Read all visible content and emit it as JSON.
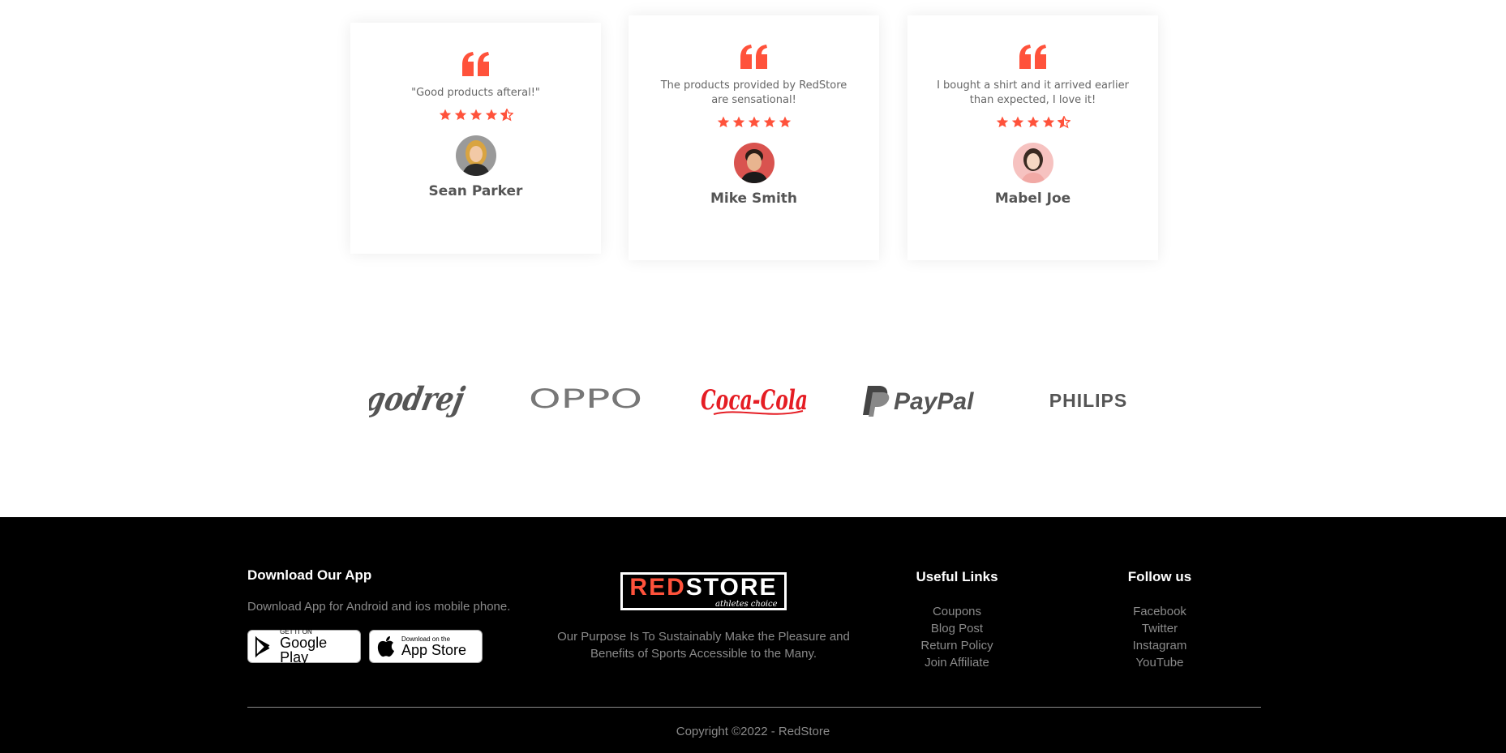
{
  "testimonials": [
    {
      "comment": "\"Good products afteral!\"",
      "rating": 4.5,
      "name": "Sean Parker"
    },
    {
      "comment": "The products provided by RedStore are sensational!",
      "rating": 5,
      "name": "Mike Smith"
    },
    {
      "comment": "I bought a shirt and it arrived earlier than expected, I love it!",
      "rating": 4.5,
      "name": "Mabel Joe"
    }
  ],
  "brands": [
    "godrej",
    "OPPO",
    "Coca-Cola",
    "PayPal",
    "PHILIPS"
  ],
  "footer": {
    "app": {
      "heading": "Download Our App",
      "text": "Download App for Android and ios mobile phone.",
      "google_small": "GET IT ON",
      "google_big": "Google Play",
      "apple_small": "Download on the",
      "apple_big": "App Store"
    },
    "logo": {
      "red": "RED",
      "white": "STORE",
      "tagline": "athletes choice"
    },
    "purpose": "Our Purpose Is To Sustainably Make the Pleasure and Benefits of Sports Accessible to the Many.",
    "useful_links": {
      "heading": "Useful Links",
      "items": [
        "Coupons",
        "Blog Post",
        "Return Policy",
        "Join Affiliate"
      ]
    },
    "follow": {
      "heading": "Follow us",
      "items": [
        "Facebook",
        "Twitter",
        "Instagram",
        "YouTube"
      ]
    },
    "copyright": "Copyright ©2022 - RedStore"
  },
  "colors": {
    "accent": "#ff523b",
    "footer_bg": "#000000",
    "muted": "#8a8a8a"
  }
}
